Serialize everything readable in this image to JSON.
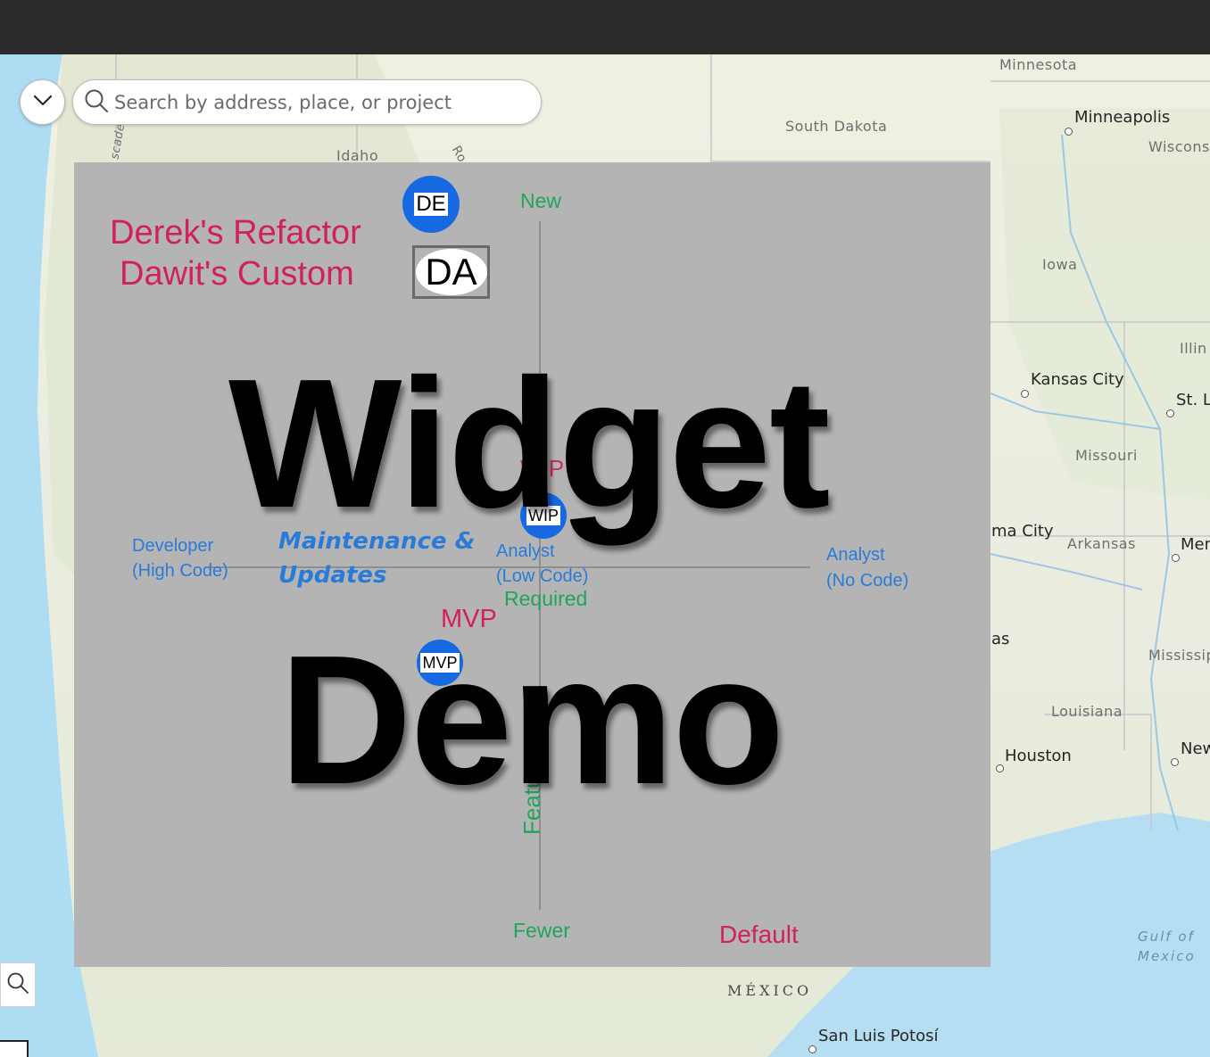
{
  "search": {
    "placeholder": "Search by address, place, or project"
  },
  "map_labels": {
    "states": [
      "Minnesota",
      "South Dakota",
      "Idaho",
      "Iowa",
      "Illin",
      "Missouri",
      "Arkansas",
      "Mississip",
      "Louisiana",
      "Wiscons"
    ],
    "cities": [
      "Minneapolis",
      "Kansas City",
      "St. Lo",
      "ma City",
      "Mem",
      "Houston",
      "New",
      "San Luis Potosí",
      "as"
    ],
    "country": "MÉXICO",
    "water": [
      "Gulf of",
      "Mexico"
    ],
    "partial": [
      "scade",
      "Ro"
    ]
  },
  "overlay": {
    "title_line1": "Widget",
    "title_line2": "Demo",
    "legend_line1": "Derek's Refactor",
    "legend_line2": "Dawit's Custom",
    "badges": {
      "de": "DE",
      "da": "DA",
      "wip": "WIP",
      "mvp": "MVP"
    },
    "axis": {
      "top": "New",
      "bottom": "Fewer",
      "required": "Required",
      "left_line1": "Developer",
      "left_line2": "(High Code)",
      "mid_line1": "Analyst",
      "mid_line2": "(Low Code)",
      "right_line1": "Analyst",
      "right_line2": "(No Code)"
    },
    "maintenance_line1": "Maintenance  &",
    "maintenance_line2": "Updates",
    "mvp_label": "MVP",
    "wip_partial": "W P",
    "default_label": "Default",
    "vertical_partial": "Features"
  },
  "colors": {
    "topbar": "#2b2b2b",
    "panel": "#b4b4b4",
    "badge": "#1669e0",
    "green": "#22a45a",
    "pink": "#d0215e",
    "blue": "#2a7bd8"
  }
}
